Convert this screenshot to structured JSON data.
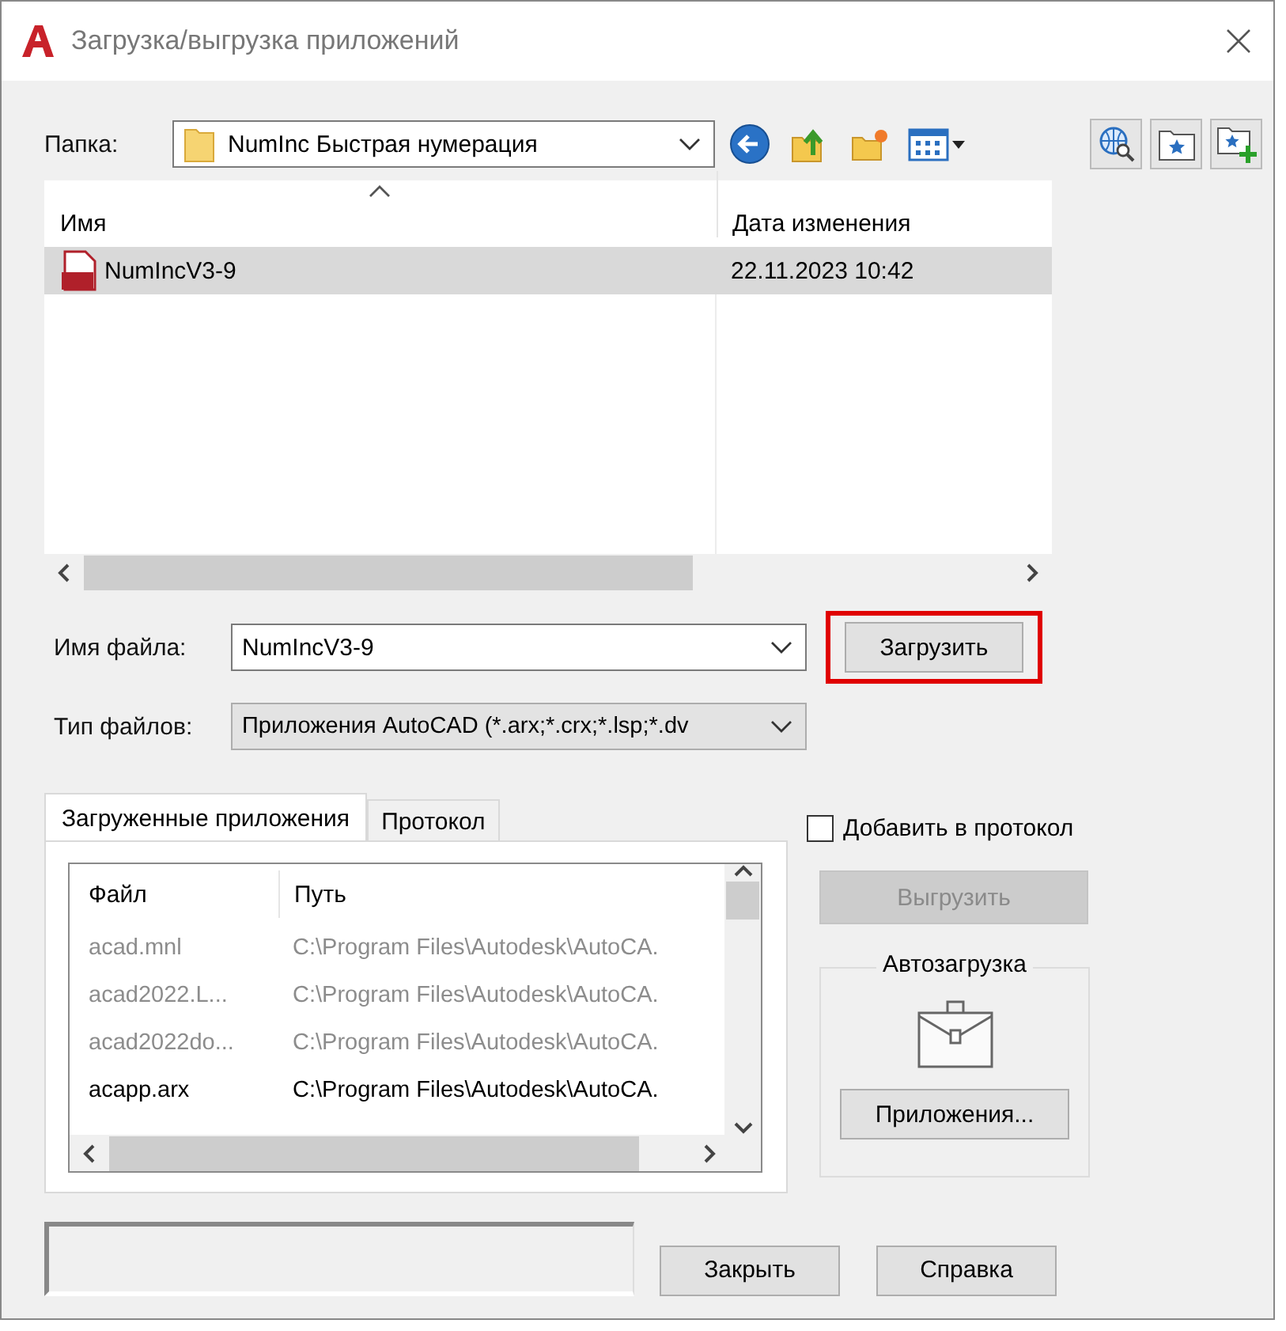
{
  "window": {
    "title": "Загрузка/выгрузка приложений"
  },
  "folder": {
    "label": "Папка:",
    "value": "NumInc Быстрая нумерация"
  },
  "file_list": {
    "columns": [
      "Имя",
      "Дата изменения"
    ],
    "rows": [
      {
        "name": "NumIncV3-9",
        "modified": "22.11.2023 10:42",
        "selected": true
      }
    ]
  },
  "file_name": {
    "label": "Имя файла:",
    "value": "NumIncV3-9"
  },
  "load_button": {
    "label": "Загрузить",
    "highlighted": true
  },
  "file_type": {
    "label": "Тип файлов:",
    "value": "Приложения AutoCAD (*.arx;*.crx;*.lsp;*.dv"
  },
  "tabs": [
    {
      "label": "Загруженные приложения",
      "selected": true
    },
    {
      "label": "Протокол",
      "selected": false
    }
  ],
  "loaded_apps": {
    "columns": [
      "Файл",
      "Путь"
    ],
    "rows": [
      {
        "file": "acad.mnl",
        "path": "C:\\Program Files\\Autodesk\\AutoCA.",
        "disabled": true
      },
      {
        "file": "acad2022.L...",
        "path": "C:\\Program Files\\Autodesk\\AutoCA.",
        "disabled": true
      },
      {
        "file": "acad2022do...",
        "path": "C:\\Program Files\\Autodesk\\AutoCA.",
        "disabled": true
      },
      {
        "file": "acapp.arx",
        "path": "C:\\Program Files\\Autodesk\\AutoCA.",
        "disabled": false
      }
    ]
  },
  "add_to_log": {
    "label": "Добавить в протокол",
    "checked": false
  },
  "unload_button": {
    "label": "Выгрузить",
    "disabled": true
  },
  "autoload": {
    "title": "Автозагрузка",
    "button": "Приложения..."
  },
  "buttons": [
    "Закрыть",
    "Справка"
  ]
}
